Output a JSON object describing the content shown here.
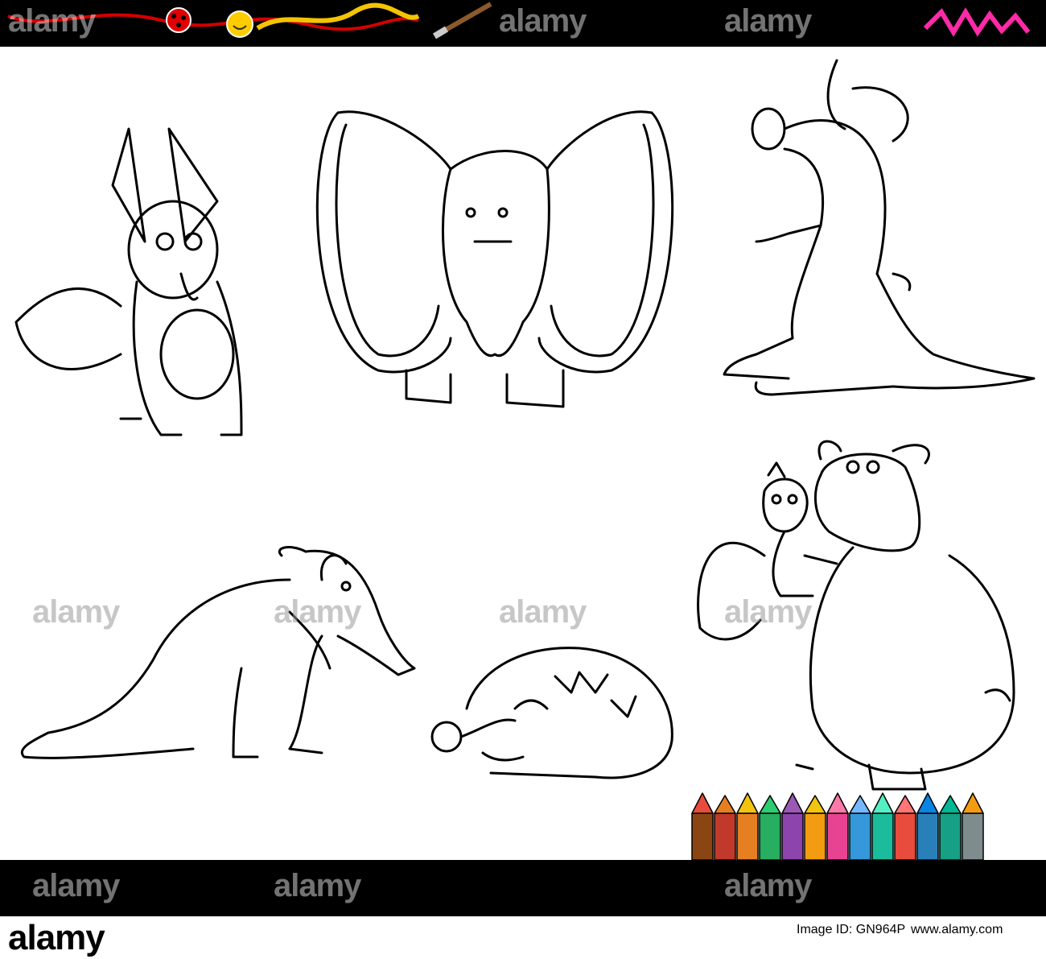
{
  "watermarks": {
    "brand": "alamy"
  },
  "footer": {
    "logo": "alamy",
    "image_id": "Image ID: GN964P",
    "url": "www.alamy.com"
  },
  "colors": {
    "bar": "#000000",
    "pencils": [
      "#8b4513",
      "#c0392b",
      "#e67e22",
      "#2ecc71",
      "#27ae60",
      "#8e44ad",
      "#f1c40f",
      "#e84393",
      "#d35400",
      "#3498db",
      "#1abc9c",
      "#9b59b6",
      "#e74c3c",
      "#f39c12",
      "#2980b9",
      "#16a085",
      "#c0392b",
      "#7f8c8d"
    ]
  }
}
